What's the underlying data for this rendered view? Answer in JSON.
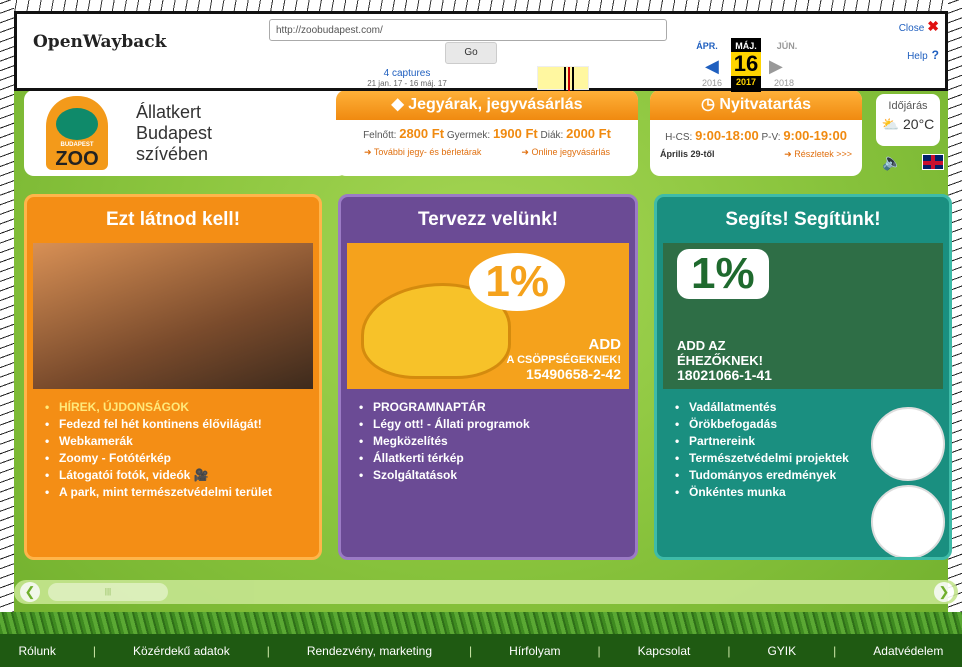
{
  "wayback": {
    "logo": "OpenWayback",
    "url": "http://zoobudapest.com/",
    "go_label": "Go",
    "captures_count": "4 captures",
    "captures_range": "21 jan. 17 - 16 máj. 17",
    "prev_month": "ÁPR.",
    "current_month": "MÁJ.",
    "next_month": "JÚN.",
    "current_day": "16",
    "current_year": "2017",
    "prev_year": "2016",
    "next_year": "2018",
    "close_label": "Close",
    "help_label": "Help"
  },
  "logo": {
    "badge_top": "BUDAPEST",
    "badge_zoo": "ZOO",
    "line1": "Állatkert",
    "line2": "Budapest",
    "line3": "szívében"
  },
  "tickets": {
    "title": "Jegyárak, jegyvásárlás",
    "adult_label": "Felnőtt:",
    "adult_price": "2800 Ft",
    "child_label": "Gyermek:",
    "child_price": "1900 Ft",
    "student_label": "Diák:",
    "student_price": "2000 Ft",
    "more_link": "➜ További jegy- és bérletárak",
    "online_link": "➜ Online jegyvásárlás"
  },
  "hours": {
    "title": "Nyitvatartás",
    "weekday_label": "H-CS:",
    "weekday_hours": "9:00-18:00",
    "weekend_label": "P-V:",
    "weekend_hours": "9:00-19:00",
    "from": "Április 29-től",
    "details": "➜ Részletek >>>"
  },
  "weather": {
    "label": "Időjárás",
    "temp": "20°C"
  },
  "columns": {
    "orange": {
      "title": "Ezt látnod kell!",
      "items": [
        "HÍREK, ÚJDONSÁGOK",
        "Fedezd fel hét kontinens élővilágát!",
        "Webkamerák",
        "Zoomy - Fotótérkép",
        "Látogatói fotók, videók",
        "A park, mint természetvédelmi terület"
      ]
    },
    "purple": {
      "title": "Tervezz velünk!",
      "percent": "1%",
      "add_line1": "ADD",
      "add_line2": "A CSÖPPSÉGEKNEK!",
      "account": "15490658-2-42",
      "items": [
        "PROGRAMNAPTÁR",
        "Légy ott! - Állati programok",
        "Megközelítés",
        "Állatkerti térkép",
        "Szolgáltatások"
      ]
    },
    "teal": {
      "title": "Segíts! Segítünk!",
      "percent": "1%",
      "add_line1": "ADD AZ",
      "add_line2": "ÉHEZŐKNEK!",
      "account": "18021066-1-41",
      "items": [
        "Vadállatmentés",
        "Örökbefogadás",
        "Partnereink",
        "Természetvédelmi projektek",
        "Tudományos eredmények",
        "Önkéntes munka"
      ]
    }
  },
  "footer": {
    "items": [
      "Rólunk",
      "Közérdekű adatok",
      "Rendezvény, marketing",
      "Hírfolyam",
      "Kapcsolat",
      "GYIK",
      "Adatvédelem"
    ],
    "separator": "|"
  }
}
